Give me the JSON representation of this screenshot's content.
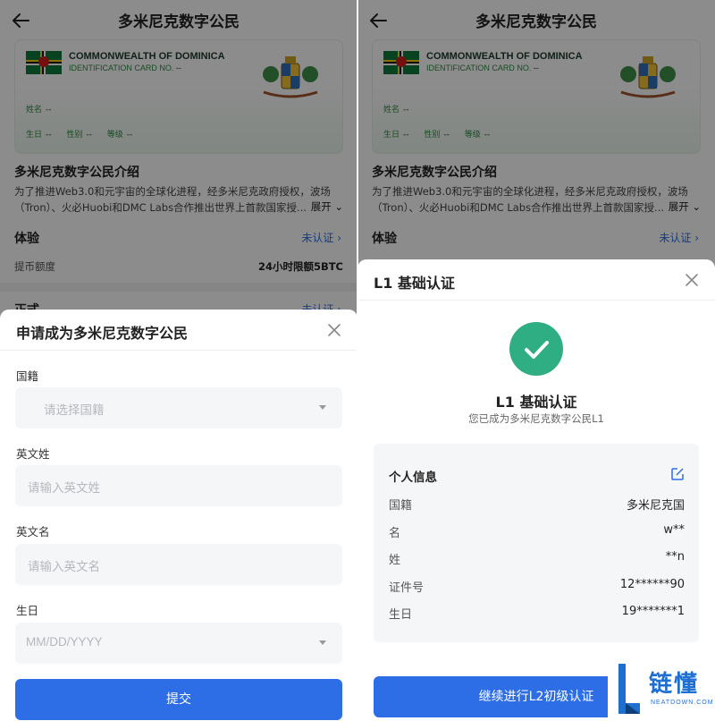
{
  "nav": {
    "title": "多米尼克数字公民"
  },
  "id_card": {
    "country": "COMMONWEALTH OF DOMINICA",
    "id_label": "IDENTIFICATION CARD NO.",
    "id_value": "--",
    "name_label": "姓名",
    "name_value": "--",
    "birth_label": "生日",
    "birth_value": "--",
    "gender_label": "性别",
    "gender_value": "--",
    "level_label": "等级",
    "level_value": "--"
  },
  "intro": {
    "title": "多米尼克数字公民介绍",
    "line1": "为了推进Web3.0和元宇宙的全球化进程，经多米尼克政府授权，波场",
    "line2": "（Tron）、火必Huobi和DMC Labs合作推出世界上首款国家授...",
    "expand": "展开"
  },
  "experience": {
    "title": "体验",
    "status": "未认证",
    "row_label": "提币额度",
    "row_value": "24小时限额5BTC"
  },
  "section2": {
    "title": "正式",
    "status": "未认证"
  },
  "apply_sheet": {
    "title": "申请成为多米尼克数字公民",
    "nationality_label": "国籍",
    "nationality_placeholder": "请选择国籍",
    "surname_label": "英文姓",
    "surname_placeholder": "请输入英文姓",
    "given_label": "英文名",
    "given_placeholder": "请输入英文名",
    "birthday_label": "生日",
    "birthday_placeholder": "MM/DD/YYYY",
    "submit": "提交"
  },
  "l1_sheet": {
    "title": "L1 基础认证",
    "success_title": "L1 基础认证",
    "success_sub": "您已成为多米尼克数字公民L1",
    "info_title": "个人信息",
    "rows": [
      {
        "label": "国籍",
        "value": "多米尼克国"
      },
      {
        "label": "名",
        "value": "w**"
      },
      {
        "label": "姓",
        "value": "**n"
      },
      {
        "label": "证件号",
        "value": "12******90"
      },
      {
        "label": "生日",
        "value": "19*******1"
      }
    ],
    "continue": "继续进行L2初级认证"
  },
  "watermark": {
    "brand": "链懂",
    "site": "NEATDOWN.COM"
  },
  "colors": {
    "primary": "#2d6ee6",
    "success": "#2fae84",
    "link": "#2a6ee6",
    "card_green": "#2c8a3f"
  },
  "icons": [
    "back-arrow-icon",
    "close-icon",
    "check-icon",
    "edit-icon",
    "chevron-right-icon",
    "dropdown-caret-icon"
  ]
}
